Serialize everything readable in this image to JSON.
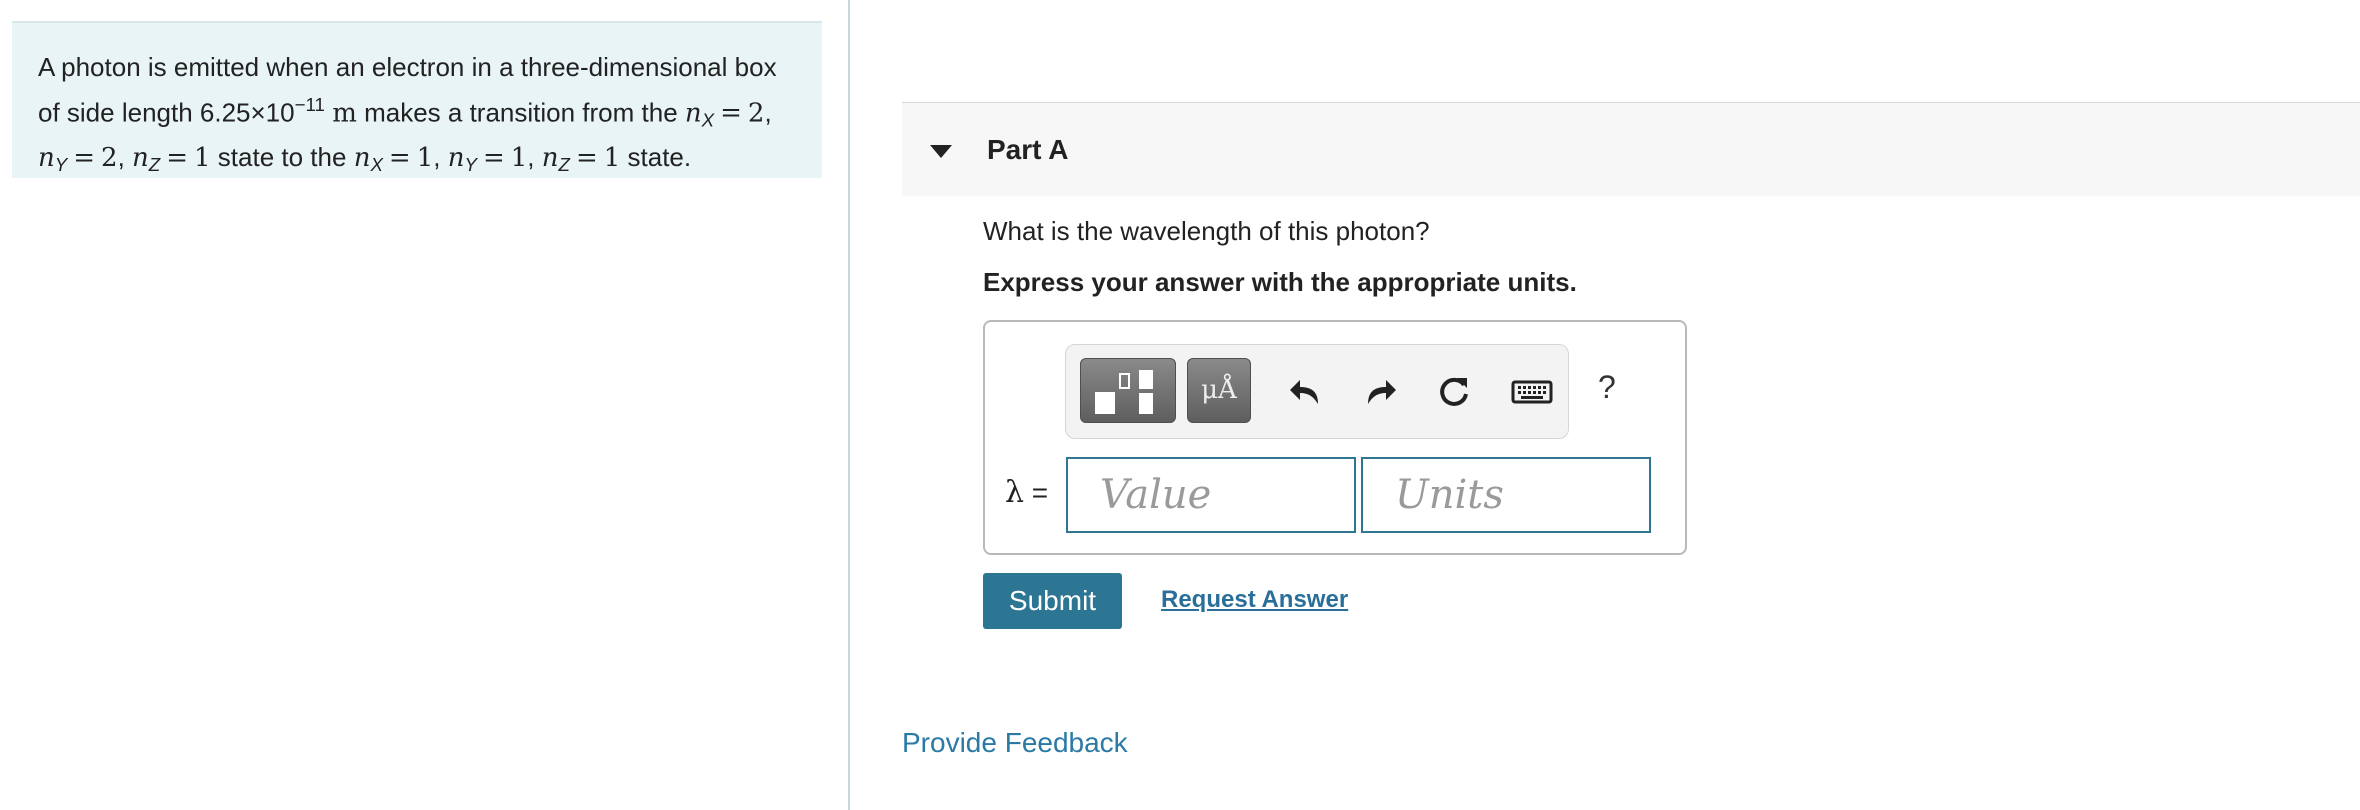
{
  "problem": {
    "intro": "A photon is emitted when an electron in a three-dimensional box",
    "line2_prefix": "of side length 6.25×10",
    "exponent": "−11",
    "unit_m": "m",
    "line2_middle": "makes a transition from the",
    "state_to_text": "state to the",
    "state_end_text": "state.",
    "initial_state": {
      "nx": "2",
      "ny": "2",
      "nz": "1"
    },
    "final_state": {
      "nx": "1",
      "ny": "1",
      "nz": "1"
    },
    "var_n": "n",
    "sub_x": "X",
    "sub_y": "Y",
    "sub_z": "Z",
    "eq": "="
  },
  "part": {
    "title": "Part A",
    "question": "What is the wavelength of this photon?",
    "instruction": "Express your answer with the appropriate units."
  },
  "toolbar": {
    "units_symbol": "μÅ",
    "help_label": "?"
  },
  "answer": {
    "label_symbol": "λ",
    "label_eq": "=",
    "value_placeholder": "Value",
    "units_placeholder": "Units"
  },
  "actions": {
    "submit_label": "Submit",
    "request_label": "Request Answer",
    "feedback_label": "Provide Feedback"
  },
  "colors": {
    "accent": "#2c7593",
    "link": "#2a7aa5",
    "problem_bg": "#e9f4f7"
  }
}
